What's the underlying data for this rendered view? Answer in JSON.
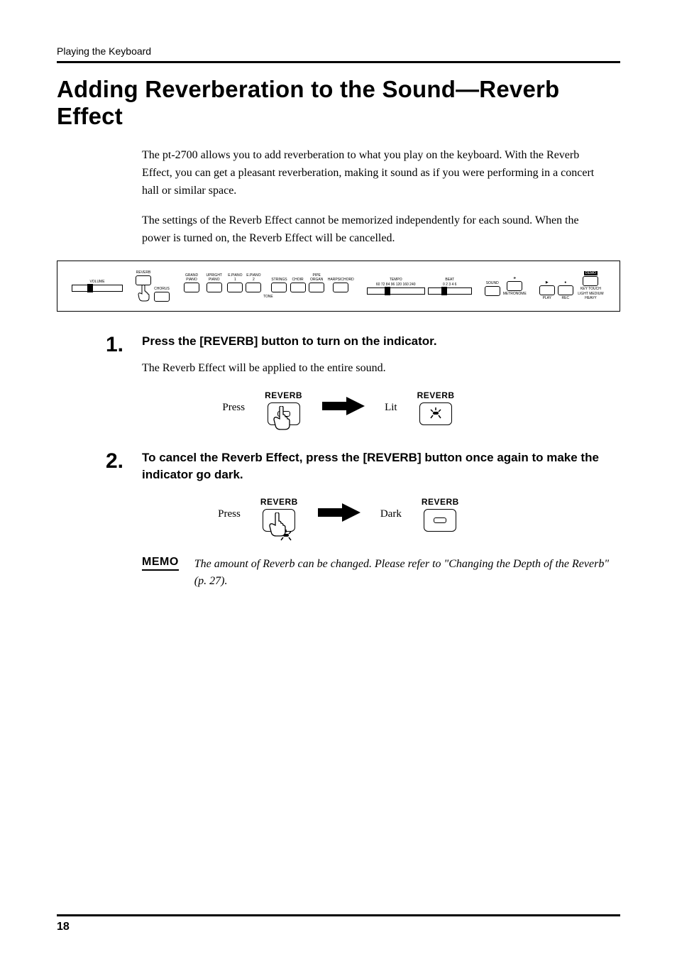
{
  "running_head": "Playing the Keyboard",
  "title": "Adding Reverberation to the Sound—Reverb Effect",
  "intro_p1": "The pt-2700 allows you to add reverberation to what you play on the keyboard. With the Reverb Effect, you can get a pleasant reverberation, making it sound as if you were performing in a concert hall or similar space.",
  "intro_p2": "The settings of the Reverb Effect cannot be memorized independently for each sound. When the power is turned on, the Reverb Effect will be cancelled.",
  "panel": {
    "volume": "VOLUME",
    "reverb": "REVERB",
    "chorus": "CHORUS",
    "tones": [
      "GRAND PIANO",
      "UPRIGHT PIANO",
      "E.PIANO 1",
      "E.PIANO 2",
      "STRINGS",
      "CHOIR",
      "PIPE ORGAN",
      "HARPSICHORD"
    ],
    "tone_label": "TONE",
    "tempo": "TEMPO",
    "tempo_marks": "60 72 84 96 120 160 240",
    "beat": "BEAT",
    "beat_marks": "0  2  3  4  6",
    "sound": "SOUND",
    "metronome": "METRONOME",
    "play": "PLAY",
    "rec": "REC",
    "demo": "DEMO",
    "key_touch": "KEY TOUCH",
    "key_touch_marks": "LIGHT  MEDIUM  HEAVY",
    "play_sym": "▶",
    "rec_sym": "●"
  },
  "steps": [
    {
      "num": "1.",
      "head": "Press the [REVERB] button to turn on the indicator.",
      "body": "The Reverb Effect will be applied to the entire sound.",
      "fig": {
        "left": "Press",
        "right": "Lit",
        "label": "REVERB"
      }
    },
    {
      "num": "2.",
      "head": "To cancel the Reverb Effect, press the [REVERB] button once again to make the indicator go dark.",
      "body": "",
      "fig": {
        "left": "Press",
        "right": "Dark",
        "label": "REVERB"
      }
    }
  ],
  "memo": {
    "badge": "MEMO",
    "text": "The amount of Reverb can be changed. Please refer to \"Changing the Depth of the Reverb\" (p. 27)."
  },
  "page_number": "18"
}
